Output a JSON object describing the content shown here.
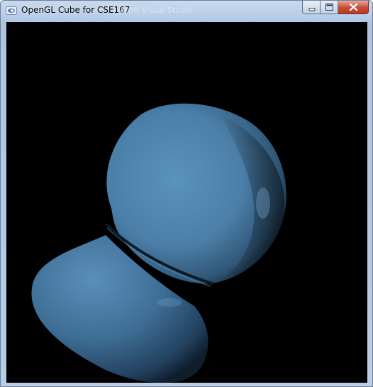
{
  "window": {
    "title": "OpenGL Cube for CSE167",
    "ghost_title": "osoft Visual Studio",
    "icon": "opengl-app-icon",
    "controls": {
      "minimize_icon": "minimize-icon",
      "maximize_icon": "maximize-icon",
      "close_icon": "close-icon"
    }
  },
  "viewport": {
    "background": "#000000",
    "object": "shaded-3d-model",
    "base_color": "#5086b0"
  },
  "colors": {
    "close_button": "#c74a36",
    "titlebar": "#b9cde6"
  }
}
